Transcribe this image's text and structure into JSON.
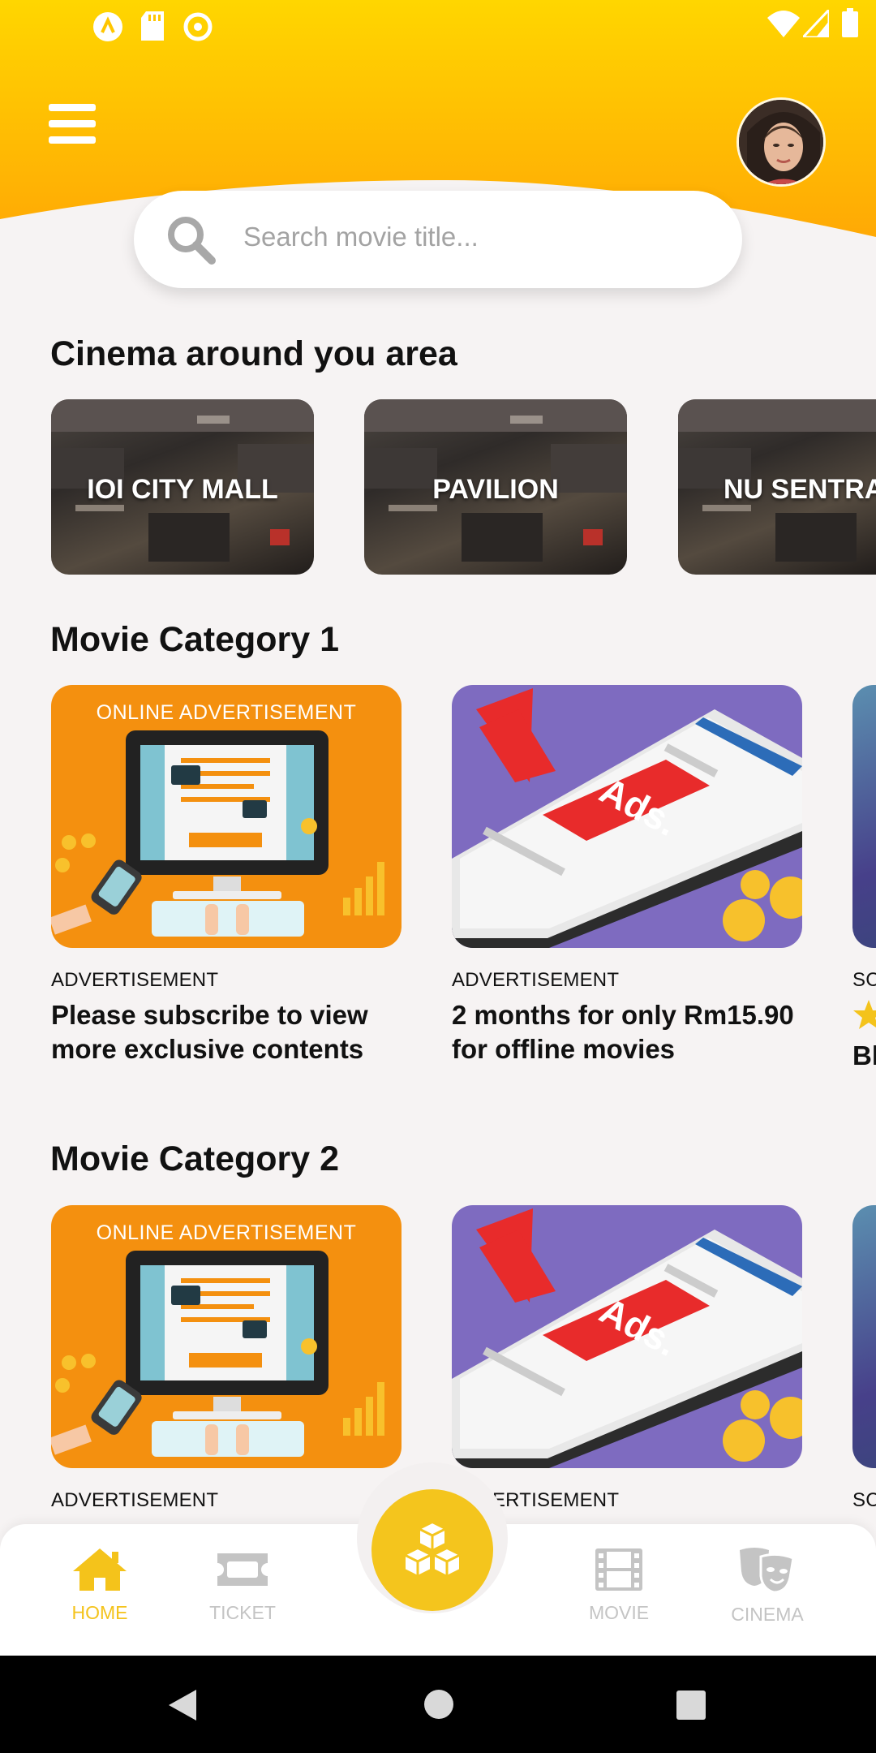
{
  "search": {
    "placeholder": "Search movie title..."
  },
  "sections": {
    "cinema_title": "Cinema around you area",
    "category1_title": "Movie Category 1",
    "category2_title": "Movie Category 2"
  },
  "cinemas": [
    {
      "name": "IOI CITY MALL"
    },
    {
      "name": "PAVILION"
    },
    {
      "name": "NU SENTRAL"
    }
  ],
  "category1": [
    {
      "poster_label": "ONLINE ADVERTISEMENT",
      "tag": "ADVERTISEMENT",
      "desc": "Please subscribe to view more exclusive contents"
    },
    {
      "poster_label": "Ads.",
      "tag": "ADVERTISEMENT",
      "desc": "2 months for only Rm15.90 for offline movies"
    },
    {
      "tag": "SC",
      "desc": "Bl"
    }
  ],
  "category2": [
    {
      "poster_label": "ONLINE ADVERTISEMENT",
      "tag": "ADVERTISEMENT"
    },
    {
      "poster_label": "Ads.",
      "tag": "ADVERTISEMENT"
    },
    {
      "tag": "SC"
    }
  ],
  "nav": {
    "home": "HOME",
    "ticket": "TICKET",
    "movie": "MOVIE",
    "cinema": "CINEMA",
    "active": "home"
  },
  "colors": {
    "accent": "#f4c31b",
    "header_top": "#ffd600",
    "header_bottom": "#ffa905",
    "inactive": "#c4c4c4"
  },
  "icons": [
    "menu-icon",
    "search-icon",
    "home-icon",
    "ticket-icon",
    "cubes-icon",
    "film-icon",
    "theater-masks-icon"
  ]
}
